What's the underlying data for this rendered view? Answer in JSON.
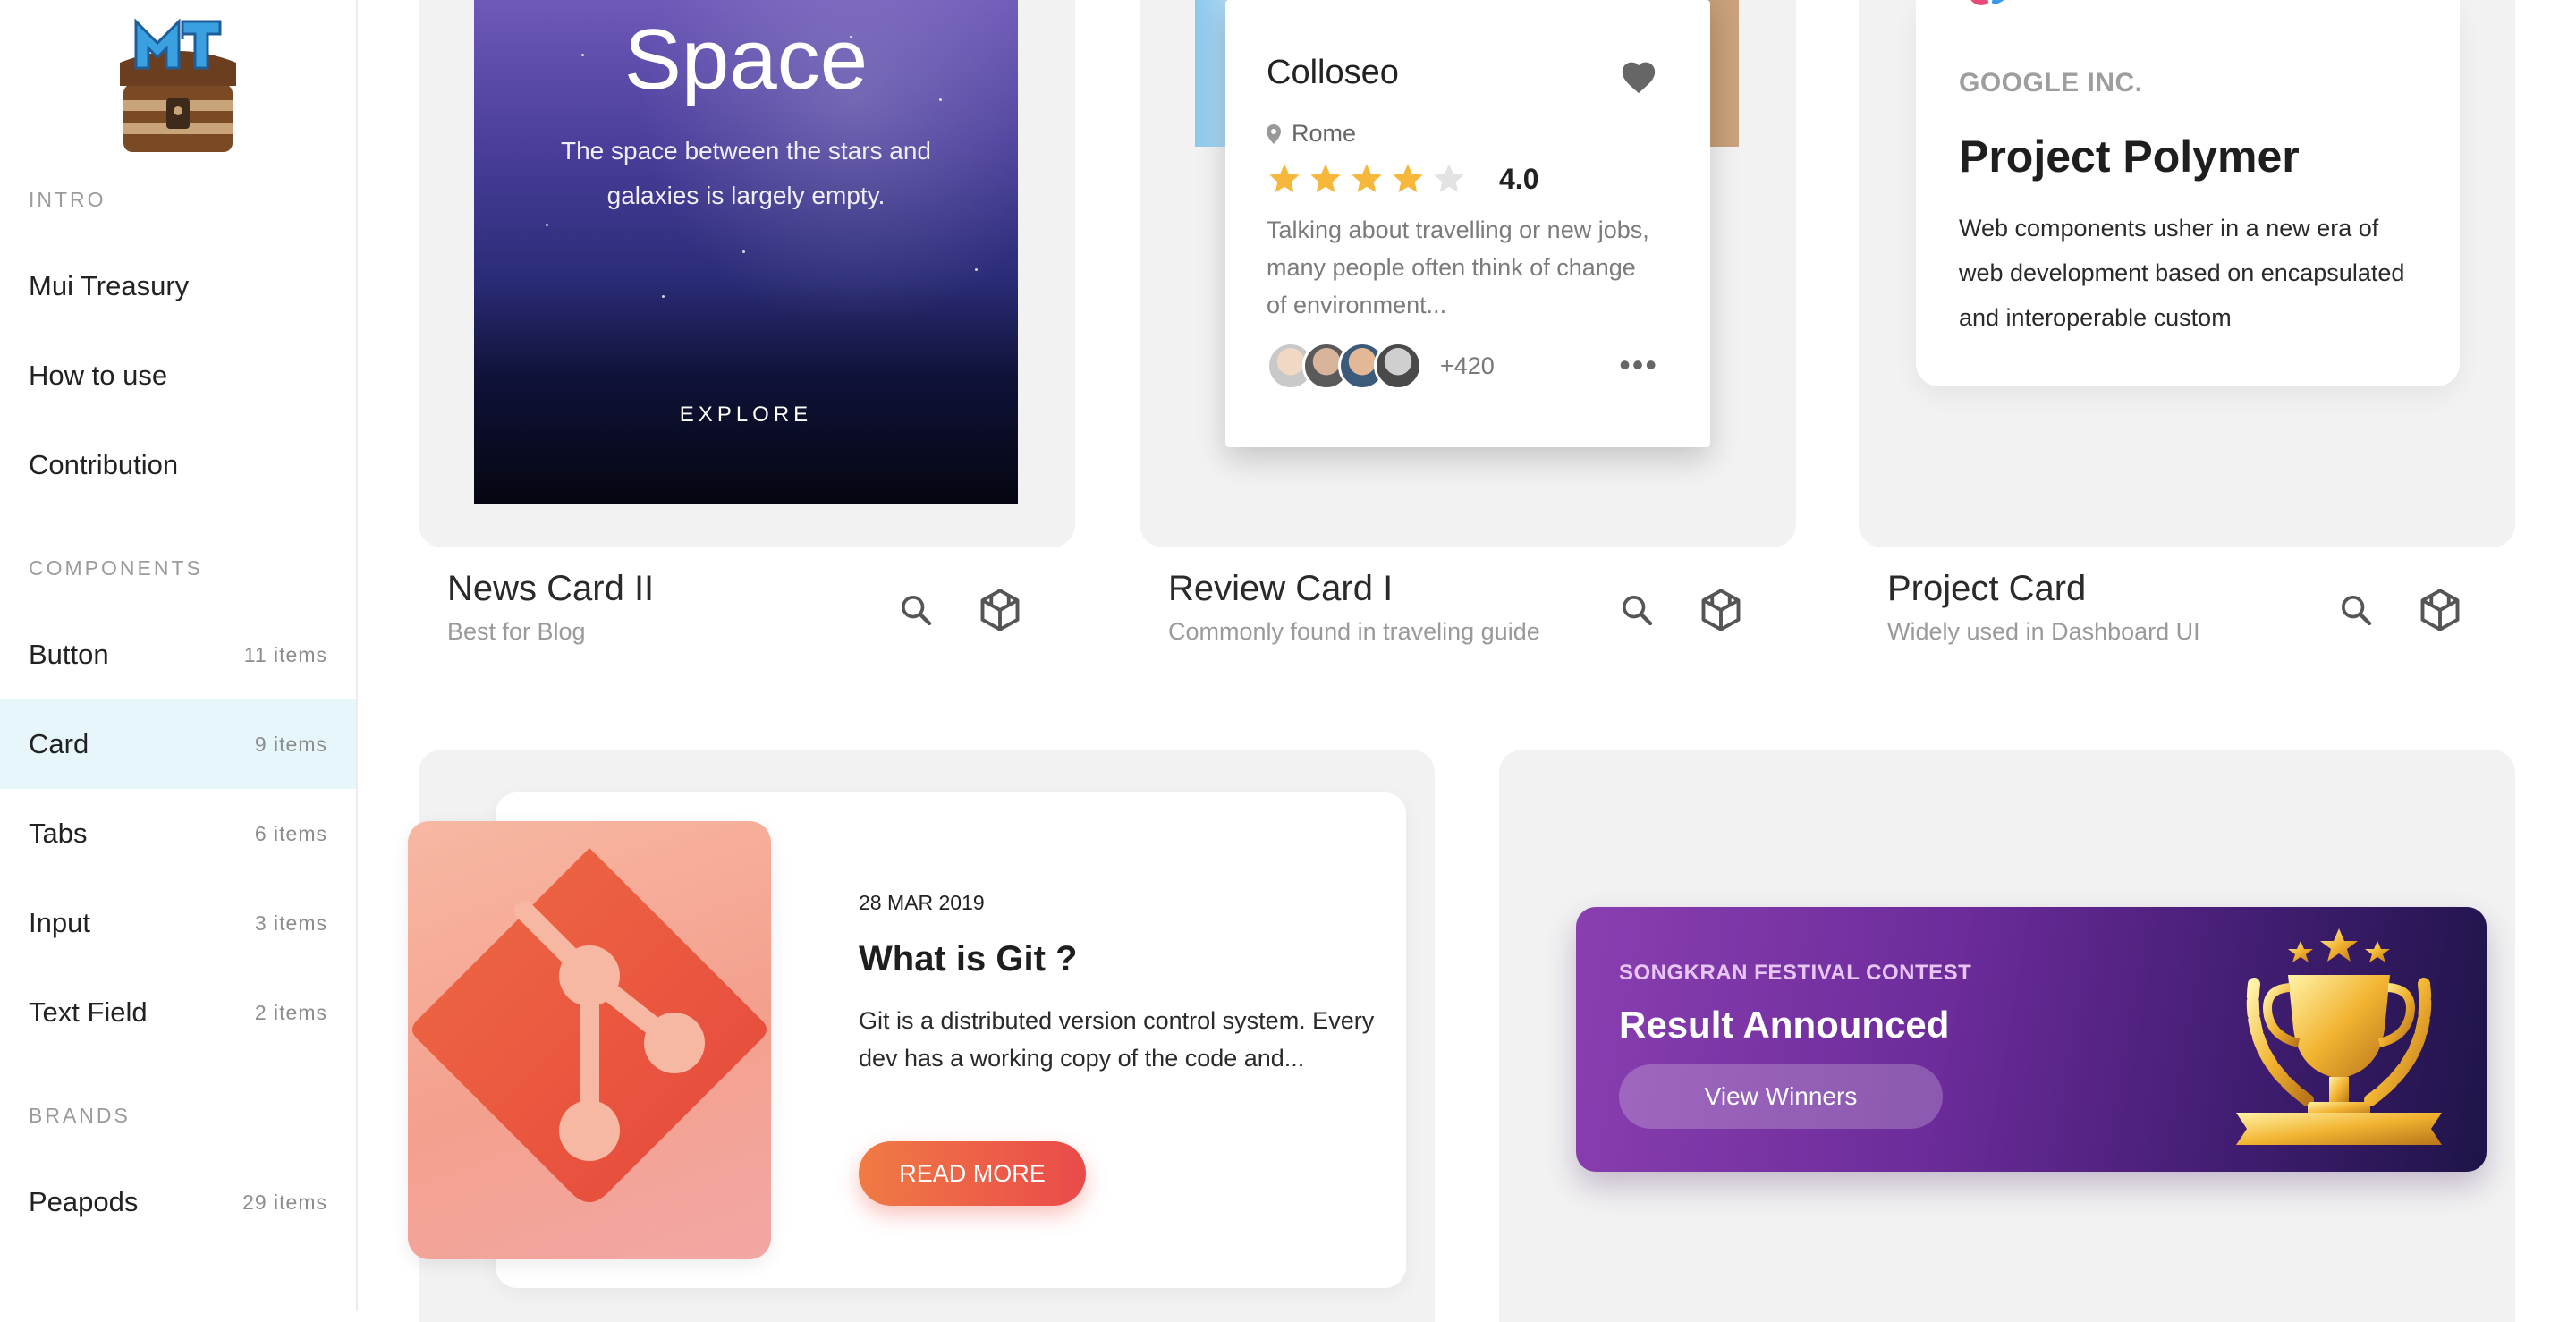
{
  "sidebar": {
    "sections": {
      "intro": "INTRO",
      "components": "COMPONENTS",
      "brands": "BRANDS"
    },
    "intro_items": [
      {
        "label": "Mui Treasury"
      },
      {
        "label": "How to use"
      },
      {
        "label": "Contribution"
      }
    ],
    "component_items": [
      {
        "label": "Button",
        "count": "11 items"
      },
      {
        "label": "Card",
        "count": "9 items",
        "active": true
      },
      {
        "label": "Tabs",
        "count": "6 items"
      },
      {
        "label": "Input",
        "count": "3 items"
      },
      {
        "label": "Text Field",
        "count": "2 items"
      }
    ],
    "brand_items": [
      {
        "label": "Peapods",
        "count": "29 items"
      }
    ]
  },
  "cards": [
    {
      "title": "News Card II",
      "subtitle": "Best for Blog"
    },
    {
      "title": "Review Card I",
      "subtitle": "Commonly found in traveling guide"
    },
    {
      "title": "Project Card",
      "subtitle": "Widely used in Dashboard UI"
    }
  ],
  "news_card": {
    "title": "Space",
    "description": "The space between the stars and galaxies is largely empty.",
    "action": "EXPLORE"
  },
  "review_card": {
    "title": "Colloseo",
    "location": "Rome",
    "rating": 4.0,
    "rating_label": "4.0",
    "stars_filled": 4,
    "stars_total": 5,
    "description": "Talking about travelling or new jobs, many people often think of change of environment...",
    "extra_count": "+420"
  },
  "project_card": {
    "company": "GOOGLE INC.",
    "title": "Project Polymer",
    "description": "Web components usher in a new era of web development based on encapsulated and interoperable custom"
  },
  "blog_card": {
    "date": "28 MAR 2019",
    "title": "What is Git ?",
    "description": "Git is a distributed version control system. Every dev has a working copy of the code and...",
    "button": "READ MORE"
  },
  "promo_card": {
    "subtitle": "SONGKRAN FESTIVAL CONTEST",
    "title": "Result Announced",
    "button": "View Winners"
  },
  "colors": {
    "active_bg": "#e7f6fa",
    "star": "#f5b83a",
    "blog_button_start": "#f07a44",
    "blog_button_end": "#ea4a4a",
    "promo_start": "#8a3fb1",
    "promo_end": "#1e1448"
  }
}
